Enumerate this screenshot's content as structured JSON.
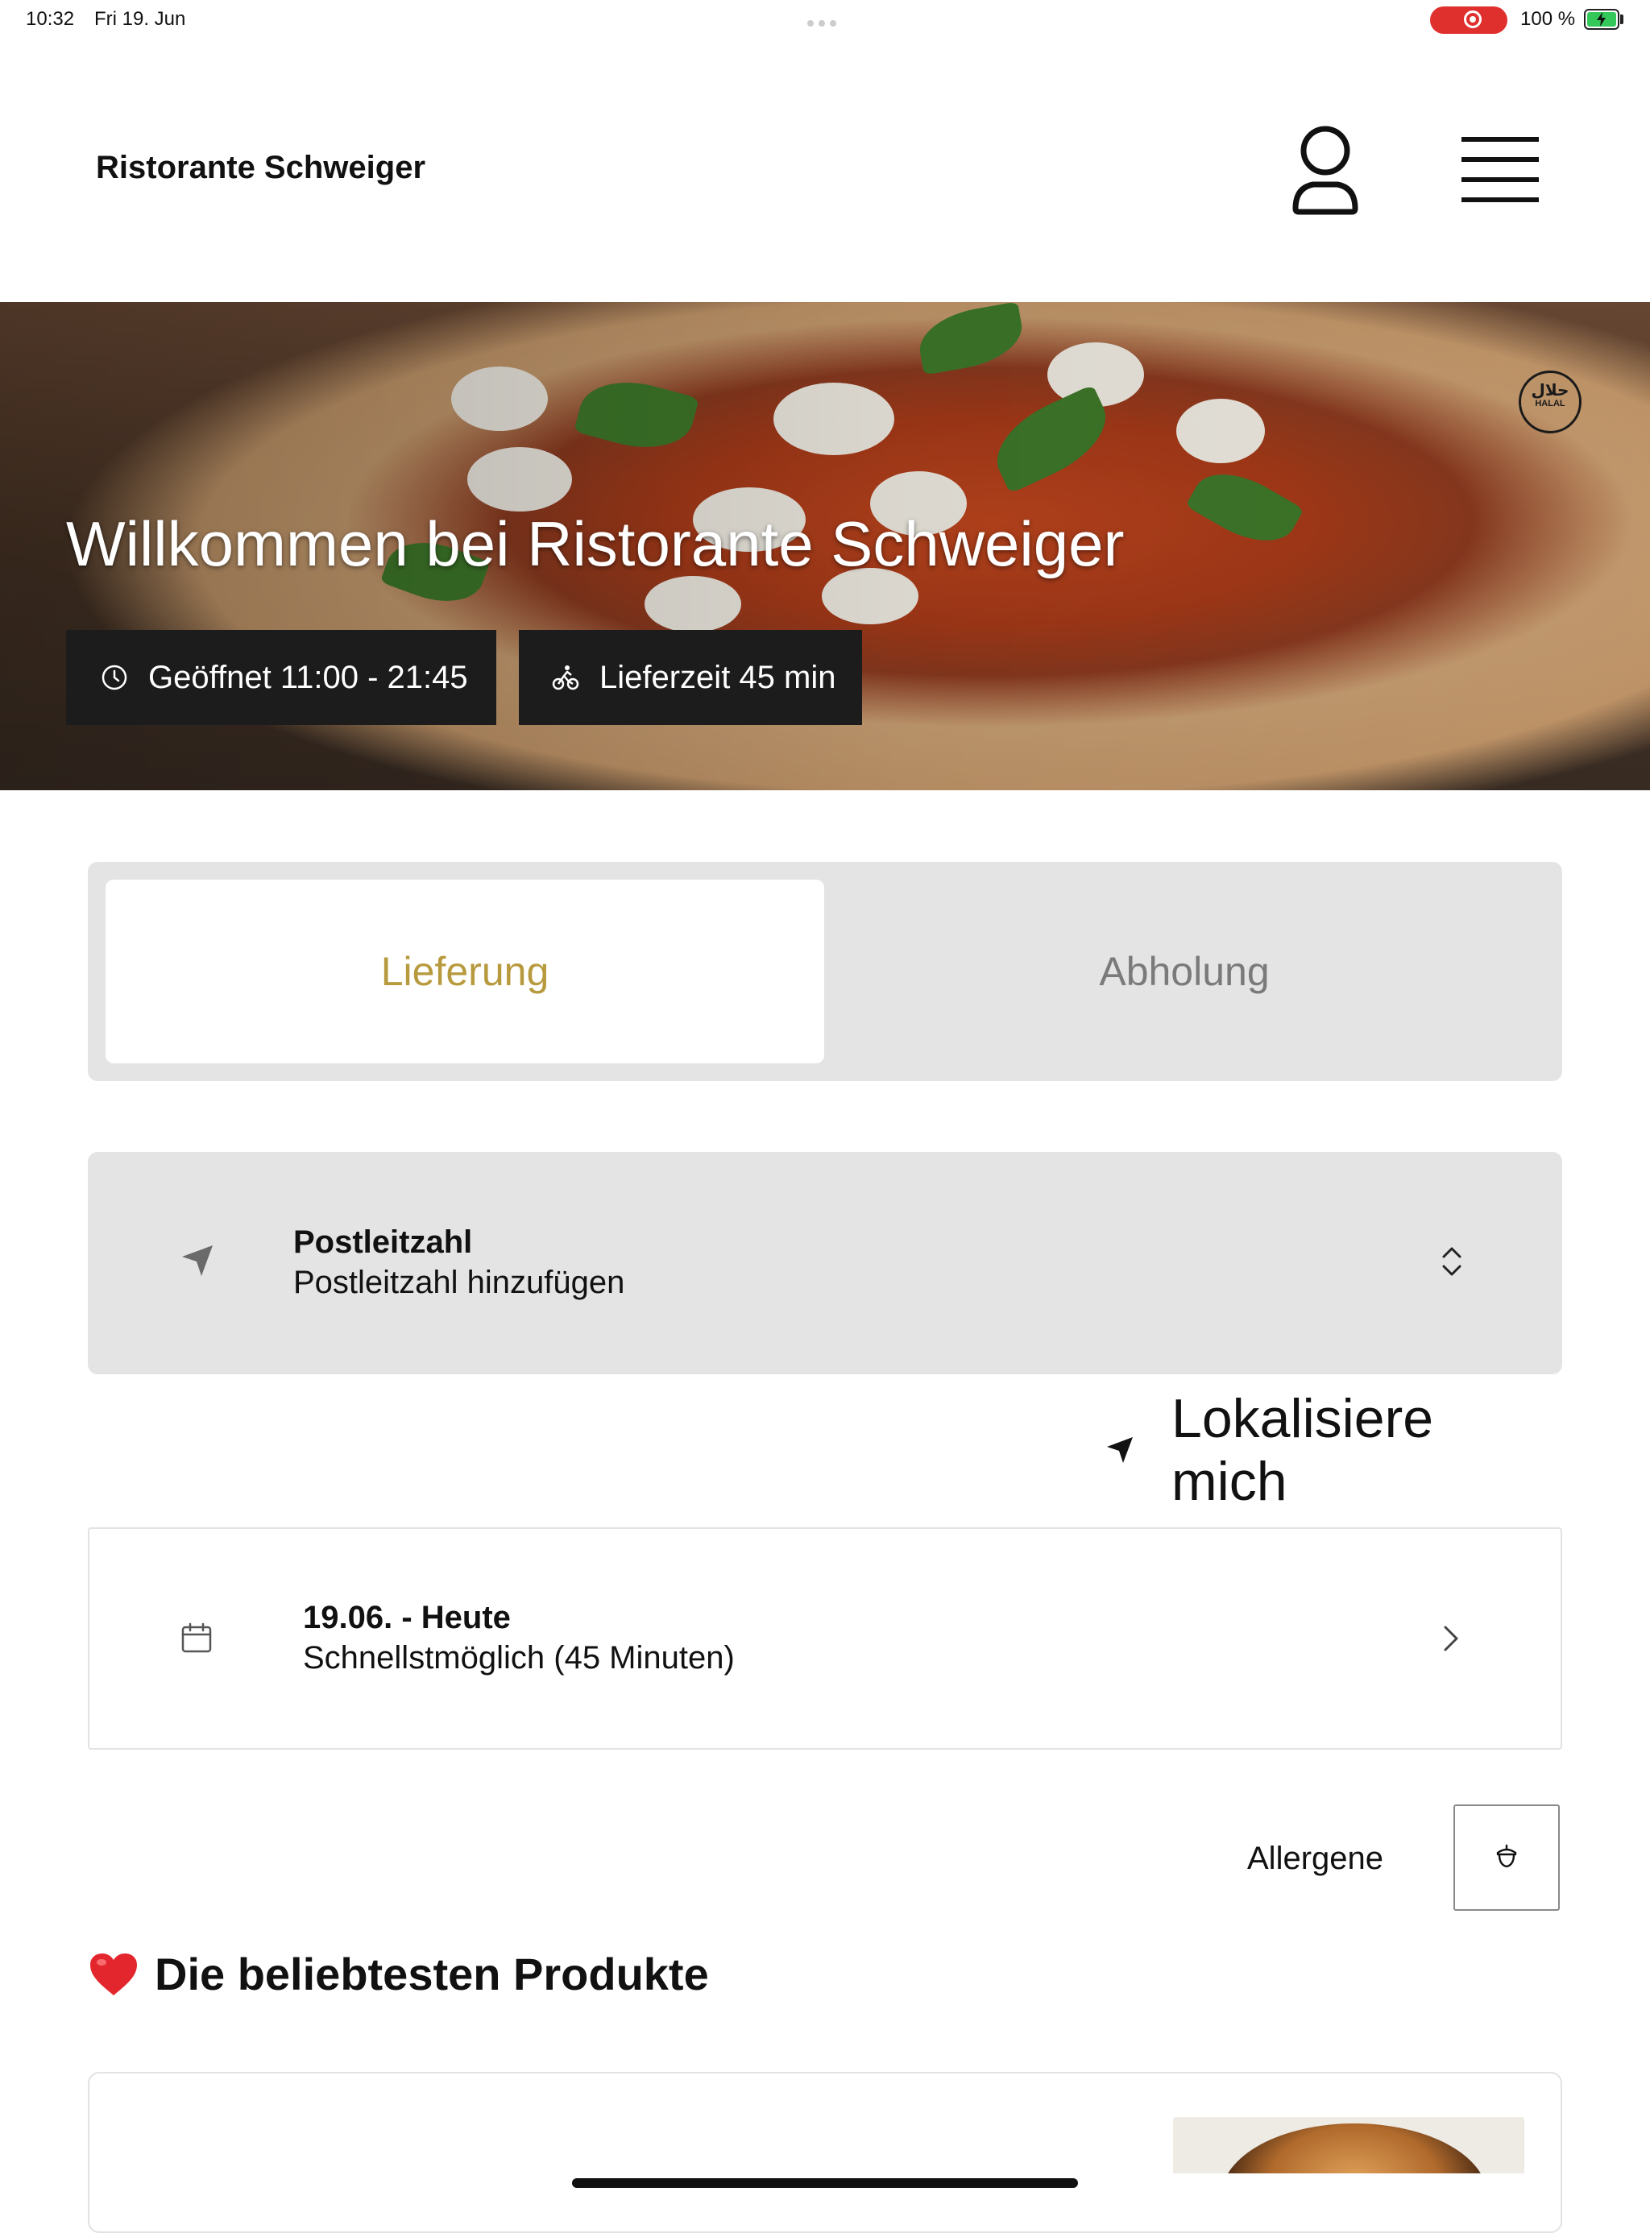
{
  "status_bar": {
    "time": "10:32",
    "date": "Fri 19. Jun",
    "battery": "100 %",
    "battery_charging": true
  },
  "header": {
    "brand": "Ristorante Schweiger",
    "icons": [
      "user-icon",
      "menu-icon"
    ]
  },
  "hero": {
    "title": "Willkommen bei Ristorante Schweiger",
    "opening_hours": "Geöffnet 11:00 - 21:45",
    "delivery_time": "Lieferzeit 45 min",
    "badge_arabic": "حلال",
    "badge_text": "HALAL"
  },
  "order_mode": {
    "options": [
      "Lieferung",
      "Abholung"
    ],
    "selected": "Lieferung",
    "active_color": "#b89a3e"
  },
  "postal_code": {
    "title": "Postleitzahl",
    "placeholder": "Postleitzahl hinzufügen"
  },
  "locate": {
    "label": "Lokalisiere mich"
  },
  "delivery_date": {
    "title": "19.06. - Heute",
    "subtitle": "Schnellstmöglich (45 Minuten)"
  },
  "allergens": {
    "label": "Allergene"
  },
  "popular": {
    "title": "Die beliebtesten Produkte",
    "emoji": "heart"
  }
}
